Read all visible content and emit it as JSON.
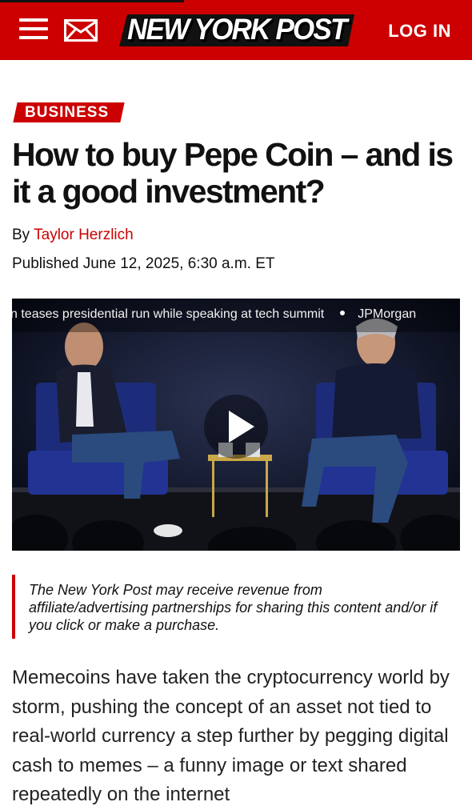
{
  "header": {
    "logo_text": "NEW YORK POST",
    "login_label": "LOG IN",
    "menu_icon": "hamburger-menu-icon",
    "mail_icon": "envelope-icon",
    "bg_color": "#cc0000"
  },
  "article": {
    "section": "BUSINESS",
    "headline": "How to buy Pepe Coin – and is it a good investment?",
    "byline_prefix": "By",
    "author": "Taylor Herzlich",
    "published": "Published June 12, 2025, 6:30 a.m. ET",
    "disclaimer": "The New York Post may receive revenue from affiliate/advertising partnerships for sharing this content and/or if you click or make a purchase.",
    "body": "Memecoins have taken the cryptocurrency world by storm, pushing the concept of an asset not tied to real-world currency a step further by pegging digital cash to memes – a funny image or text shared repeatedly on the internet"
  },
  "video": {
    "ticker_text_1": "n teases presidential run while speaking at tech summit",
    "ticker_text_2": "JPMorgan",
    "play_icon": "play-icon"
  }
}
